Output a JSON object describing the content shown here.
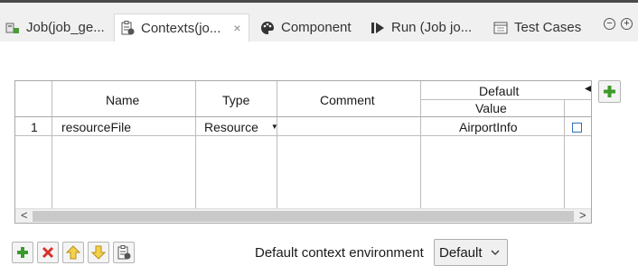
{
  "tabs": [
    {
      "label": "Job(job_ge...",
      "icon": "job-icon",
      "active": false
    },
    {
      "label": "Contexts(jo...",
      "icon": "contexts-icon",
      "active": true,
      "close": "×"
    },
    {
      "label": "Component",
      "icon": "palette-icon",
      "active": false
    },
    {
      "label": "Run (Job jo...",
      "icon": "run-icon",
      "active": false
    },
    {
      "label": "Test Cases",
      "icon": "test-cases-icon",
      "active": false
    }
  ],
  "window_controls": {
    "minimize": "−",
    "maximize": "+"
  },
  "table": {
    "headers": {
      "name": "Name",
      "type": "Type",
      "comment": "Comment",
      "default": "Default",
      "value": "Value"
    },
    "rows": [
      {
        "index": "1",
        "name": "resourceFile",
        "type": "Resource",
        "comment": "",
        "value": "AirportInfo",
        "prompt_checked": false
      }
    ]
  },
  "default_context": {
    "label": "Default context environment",
    "selected": "Default"
  },
  "colors": {
    "add": "#3c9a2a",
    "remove": "#d9302b",
    "arrow": "#e8b820"
  }
}
